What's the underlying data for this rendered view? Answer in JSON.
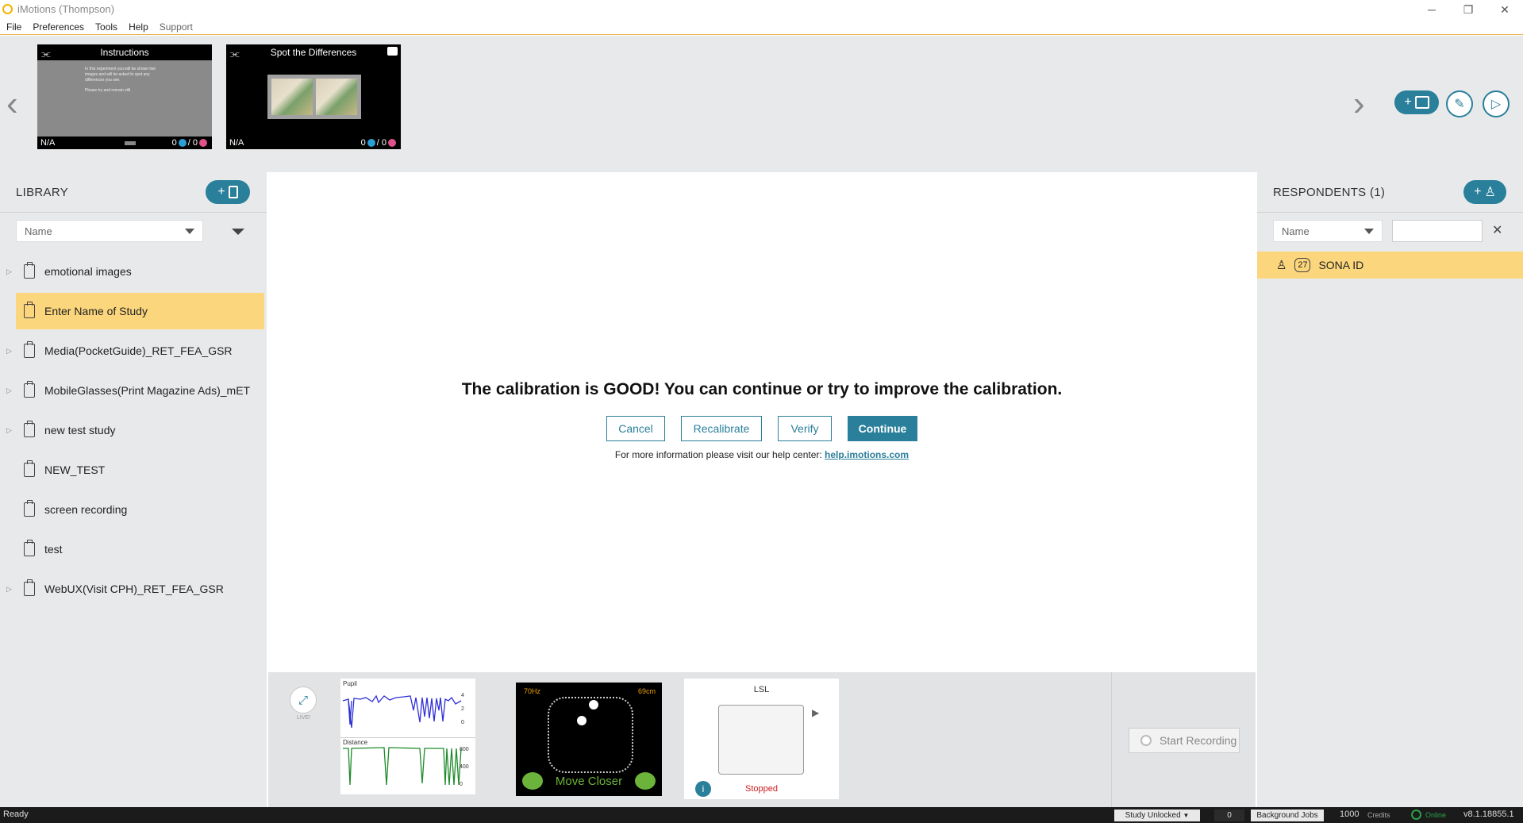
{
  "window": {
    "title": "iMotions (Thompson)",
    "minimize": "─",
    "restore": "❐",
    "close": "✕"
  },
  "menu": [
    "File",
    "Preferences",
    "Tools",
    "Help",
    "Support"
  ],
  "stimuli": [
    {
      "title": "Instructions",
      "na": "N/A",
      "count_a": "0",
      "count_b": "/ 0",
      "body_lines": [
        "In this experiment you will be shown two",
        "images and will be asked to spot any",
        "differences you see.",
        "",
        "Please try and remain still."
      ]
    },
    {
      "title": "Spot the Differences",
      "na": "N/A",
      "count_a": "0",
      "count_b": "/ 0"
    }
  ],
  "library": {
    "title": "LIBRARY",
    "sort_label": "Name",
    "items": [
      {
        "label": "emotional images",
        "expandable": true
      },
      {
        "label": "Enter Name of Study",
        "expandable": false,
        "selected": true
      },
      {
        "label": "Media(PocketGuide)_RET_FEA_GSR",
        "expandable": true
      },
      {
        "label": "MobileGlasses(Print Magazine Ads)_mET",
        "expandable": true
      },
      {
        "label": "new test study",
        "expandable": true
      },
      {
        "label": "NEW_TEST",
        "expandable": false
      },
      {
        "label": "screen recording",
        "expandable": false
      },
      {
        "label": "test",
        "expandable": false
      },
      {
        "label": "WebUX(Visit CPH)_RET_FEA_GSR",
        "expandable": true
      }
    ]
  },
  "calibration": {
    "message": "The calibration is GOOD! You can continue or try to improve the calibration.",
    "buttons": {
      "cancel": "Cancel",
      "recalibrate": "Recalibrate",
      "verify": "Verify",
      "continue": "Continue"
    },
    "help_text": "For more information please visit our help center: ",
    "help_link": "help.imotions.com"
  },
  "respondents": {
    "title": "RESPONDENTS (1)",
    "sort_label": "Name",
    "search_value": "",
    "items": [
      {
        "count": "27",
        "label": "SONA ID"
      }
    ]
  },
  "sensor": {
    "live_label": "LIVE!",
    "pupil_label": "Pupil",
    "pupil_ticks": [
      "4",
      "2",
      "0"
    ],
    "distance_label": "Distance",
    "distance_ticks": [
      "800",
      "400",
      "0"
    ],
    "rate": "70Hz",
    "distance": "69cm",
    "move_msg": "Move Closer",
    "lsl_title": "LSL",
    "lsl_status": "Stopped",
    "record_label": "Start Recording"
  },
  "status": {
    "left": "Ready",
    "lock": "Study Unlocked",
    "jobs_count": "0",
    "jobs_label": "Background Jobs",
    "credits_num": "1000",
    "credits_label": "Credits",
    "online": "Online",
    "version": "v8.1.18855.1"
  },
  "colors": {
    "accent": "#2a7f9b",
    "selection": "#fbd67c",
    "title_accent": "#e9b24a",
    "pupil": "#2f2fd6",
    "distance": "#1e8a2a",
    "stopped": "#cc1f1f",
    "gaze_text": "#f0a000",
    "move_text": "#6bb33a"
  }
}
